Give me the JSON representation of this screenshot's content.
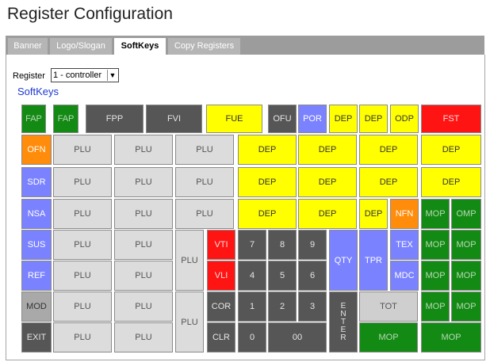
{
  "page": {
    "title": "Register Configuration"
  },
  "tabs": [
    {
      "label": "Banner",
      "active": false
    },
    {
      "label": "Logo/Slogan",
      "active": false
    },
    {
      "label": "SoftKeys",
      "active": true
    },
    {
      "label": "Copy Registers",
      "active": false
    }
  ],
  "register": {
    "label": "Register",
    "selected": "1 - controller"
  },
  "softkeys_heading": "SoftKeys",
  "keys": [
    {
      "id": "r1-fap1",
      "label": "FAP",
      "color": "green"
    },
    {
      "id": "r1-fap2",
      "label": "FAP",
      "color": "green"
    },
    {
      "id": "r1-fpp",
      "label": "FPP",
      "color": "dark"
    },
    {
      "id": "r1-fvi",
      "label": "FVI",
      "color": "dark"
    },
    {
      "id": "r1-fue",
      "label": "FUE",
      "color": "yellow"
    },
    {
      "id": "r1-ofu",
      "label": "OFU",
      "color": "dark"
    },
    {
      "id": "r1-por",
      "label": "POR",
      "color": "blue"
    },
    {
      "id": "r1-dep1",
      "label": "DEP",
      "color": "yellow"
    },
    {
      "id": "r1-dep2",
      "label": "DEP",
      "color": "yellow"
    },
    {
      "id": "r1-odp",
      "label": "ODP",
      "color": "yellow"
    },
    {
      "id": "r1-fst",
      "label": "FST",
      "color": "red"
    },
    {
      "id": "r2-ofn",
      "label": "OFN",
      "color": "orange"
    },
    {
      "id": "r2-plu1",
      "label": "PLU",
      "color": "plu"
    },
    {
      "id": "r2-plu2",
      "label": "PLU",
      "color": "plu"
    },
    {
      "id": "r2-plu3",
      "label": "PLU",
      "color": "plu"
    },
    {
      "id": "r2-dep1",
      "label": "DEP",
      "color": "yellow"
    },
    {
      "id": "r2-dep2",
      "label": "DEP",
      "color": "yellow"
    },
    {
      "id": "r2-dep3",
      "label": "DEP",
      "color": "yellow"
    },
    {
      "id": "r2-dep4",
      "label": "DEP",
      "color": "yellow"
    },
    {
      "id": "r3-sdr",
      "label": "SDR",
      "color": "blue"
    },
    {
      "id": "r3-plu1",
      "label": "PLU",
      "color": "plu"
    },
    {
      "id": "r3-plu2",
      "label": "PLU",
      "color": "plu"
    },
    {
      "id": "r3-plu3",
      "label": "PLU",
      "color": "plu"
    },
    {
      "id": "r3-dep1",
      "label": "DEP",
      "color": "yellow"
    },
    {
      "id": "r3-dep2",
      "label": "DEP",
      "color": "yellow"
    },
    {
      "id": "r3-dep3",
      "label": "DEP",
      "color": "yellow"
    },
    {
      "id": "r3-dep4",
      "label": "DEP",
      "color": "yellow"
    },
    {
      "id": "r4-nsa",
      "label": "NSA",
      "color": "blue"
    },
    {
      "id": "r4-plu1",
      "label": "PLU",
      "color": "plu"
    },
    {
      "id": "r4-plu2",
      "label": "PLU",
      "color": "plu"
    },
    {
      "id": "r4-plu3",
      "label": "PLU",
      "color": "plu"
    },
    {
      "id": "r4-dep1",
      "label": "DEP",
      "color": "yellow"
    },
    {
      "id": "r4-dep2",
      "label": "DEP",
      "color": "yellow"
    },
    {
      "id": "r4-dep3",
      "label": "DEP",
      "color": "yellow"
    },
    {
      "id": "r4-nfn",
      "label": "NFN",
      "color": "orange"
    },
    {
      "id": "r4-mop",
      "label": "MOP",
      "color": "green"
    },
    {
      "id": "r4-omp",
      "label": "OMP",
      "color": "green"
    },
    {
      "id": "r5-sus",
      "label": "SUS",
      "color": "blue"
    },
    {
      "id": "r5-plu1",
      "label": "PLU",
      "color": "plu"
    },
    {
      "id": "r5-plu2",
      "label": "PLU",
      "color": "plu"
    },
    {
      "id": "r56-plu",
      "label": "PLU",
      "color": "plu"
    },
    {
      "id": "r5-vti",
      "label": "VTI",
      "color": "red"
    },
    {
      "id": "r5-7",
      "label": "7",
      "color": "dark"
    },
    {
      "id": "r5-8",
      "label": "8",
      "color": "dark"
    },
    {
      "id": "r5-9",
      "label": "9",
      "color": "dark"
    },
    {
      "id": "r56-qty",
      "label": "QTY",
      "color": "blue"
    },
    {
      "id": "r56-tpr",
      "label": "TPR",
      "color": "blue"
    },
    {
      "id": "r5-tex",
      "label": "TEX",
      "color": "blue"
    },
    {
      "id": "r5-mop1",
      "label": "MOP",
      "color": "green"
    },
    {
      "id": "r5-mop2",
      "label": "MOP",
      "color": "green"
    },
    {
      "id": "r6-ref",
      "label": "REF",
      "color": "blue"
    },
    {
      "id": "r6-plu1",
      "label": "PLU",
      "color": "plu"
    },
    {
      "id": "r6-plu2",
      "label": "PLU",
      "color": "plu"
    },
    {
      "id": "r6-vli",
      "label": "VLI",
      "color": "red"
    },
    {
      "id": "r6-4",
      "label": "4",
      "color": "dark"
    },
    {
      "id": "r6-5",
      "label": "5",
      "color": "dark"
    },
    {
      "id": "r6-6",
      "label": "6",
      "color": "dark"
    },
    {
      "id": "r6-mdc",
      "label": "MDC",
      "color": "blue"
    },
    {
      "id": "r6-mop1",
      "label": "MOP",
      "color": "green"
    },
    {
      "id": "r6-mop2",
      "label": "MOP",
      "color": "green"
    },
    {
      "id": "r7-mod",
      "label": "MOD",
      "color": "mod"
    },
    {
      "id": "r7-plu1",
      "label": "PLU",
      "color": "plu"
    },
    {
      "id": "r7-plu2",
      "label": "PLU",
      "color": "plu"
    },
    {
      "id": "r78-plu",
      "label": "PLU",
      "color": "plu"
    },
    {
      "id": "r7-cor",
      "label": "COR",
      "color": "dark"
    },
    {
      "id": "r7-1",
      "label": "1",
      "color": "dark"
    },
    {
      "id": "r7-2",
      "label": "2",
      "color": "dark"
    },
    {
      "id": "r7-3",
      "label": "3",
      "color": "dark"
    },
    {
      "id": "r78-enter",
      "label": "E N T E R",
      "color": "dark"
    },
    {
      "id": "r7-tot",
      "label": "TOT",
      "color": "ltgray"
    },
    {
      "id": "r7-mop1",
      "label": "MOP",
      "color": "green"
    },
    {
      "id": "r7-mop2",
      "label": "MOP",
      "color": "green"
    },
    {
      "id": "r8-exit",
      "label": "EXIT",
      "color": "dark"
    },
    {
      "id": "r8-plu1",
      "label": "PLU",
      "color": "plu"
    },
    {
      "id": "r8-plu2",
      "label": "PLU",
      "color": "plu"
    },
    {
      "id": "r8-clr",
      "label": "CLR",
      "color": "dark"
    },
    {
      "id": "r8-0",
      "label": "0",
      "color": "dark"
    },
    {
      "id": "r8-00",
      "label": "00",
      "color": "dark"
    },
    {
      "id": "r8-mop1",
      "label": "MOP",
      "color": "green"
    },
    {
      "id": "r8-mop2",
      "label": "MOP",
      "color": "green"
    }
  ]
}
